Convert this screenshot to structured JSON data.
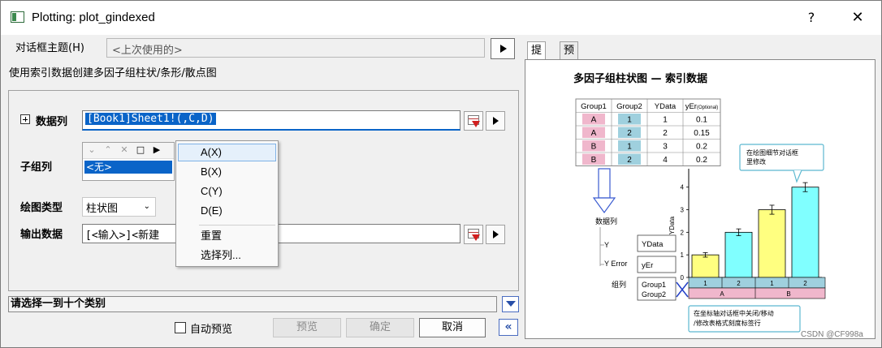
{
  "window": {
    "title": "Plotting: plot_gindexed",
    "help": "?",
    "close": "✕"
  },
  "theme": {
    "label": "对话框主题(H)",
    "value": "<上次使用的>"
  },
  "description": "使用索引数据创建多因子组柱状/条形/散点图",
  "data_column": {
    "label": "数据列",
    "value": "[Book1]Sheet1!(,C,D)"
  },
  "subgroup": {
    "label": "子组列",
    "tools": [
      "⌄",
      "⌃",
      "✕",
      "□",
      "▶"
    ],
    "item": "<无>"
  },
  "context_menu": {
    "items": [
      "A(X)",
      "B(X)",
      "C(Y)",
      "D(E)",
      "重置",
      "选择列..."
    ],
    "highlighted": "A(X)"
  },
  "plot_type": {
    "label": "绘图类型",
    "value": "柱状图"
  },
  "output": {
    "label": "输出数据",
    "value": "[<输入>]<新建"
  },
  "status": {
    "message": "请选择一到十个类别"
  },
  "footer": {
    "auto_preview": "自动预览",
    "preview": "预览",
    "ok": "确定",
    "cancel": "取消",
    "collapse": "«"
  },
  "tabs": [
    "提示",
    "预览"
  ],
  "preview": {
    "title": "多因子组柱状图 — 索引数据",
    "table": {
      "headers": [
        "Group1",
        "Group2",
        "YData",
        "yEr"
      ],
      "header_suffix": "(Optional)",
      "rows": [
        [
          "A",
          "1",
          "1",
          "0.1"
        ],
        [
          "A",
          "2",
          "2",
          "0.15"
        ],
        [
          "B",
          "1",
          "3",
          "0.2"
        ],
        [
          "B",
          "2",
          "4",
          "0.2"
        ]
      ]
    },
    "callout_top": [
      "在绘图细节对话框",
      "里修改"
    ],
    "callout_bottom": [
      "在坐标轴对话框中关闭/移动",
      "/修改表格式刻度标签行"
    ],
    "legend": {
      "data_col": "数据列",
      "y": "Y",
      "yerror": "Y Error",
      "group_col": "组列",
      "ydata_box": "YData",
      "yer_box": "yEr",
      "group_box": [
        "Group1",
        "Group2"
      ]
    },
    "ylabel": "YData",
    "y_ticks": [
      "0",
      "1",
      "2",
      "3",
      "4"
    ],
    "bottom_labels_row1": [
      "1",
      "2",
      "1",
      "2"
    ],
    "bottom_labels_row2": [
      "A",
      "B"
    ]
  },
  "chart_data": {
    "type": "bar",
    "categories": [
      "A-1",
      "A-2",
      "B-1",
      "B-2"
    ],
    "values": [
      1,
      2,
      3,
      4
    ],
    "errors": [
      0.1,
      0.15,
      0.2,
      0.2
    ],
    "colors": [
      "#ffff80",
      "#80ffff",
      "#ffff80",
      "#80ffff"
    ],
    "title": "",
    "xlabel": "",
    "ylabel": "YData",
    "ylim": [
      0,
      4.6
    ]
  },
  "watermark": "CSDN @CF998a"
}
